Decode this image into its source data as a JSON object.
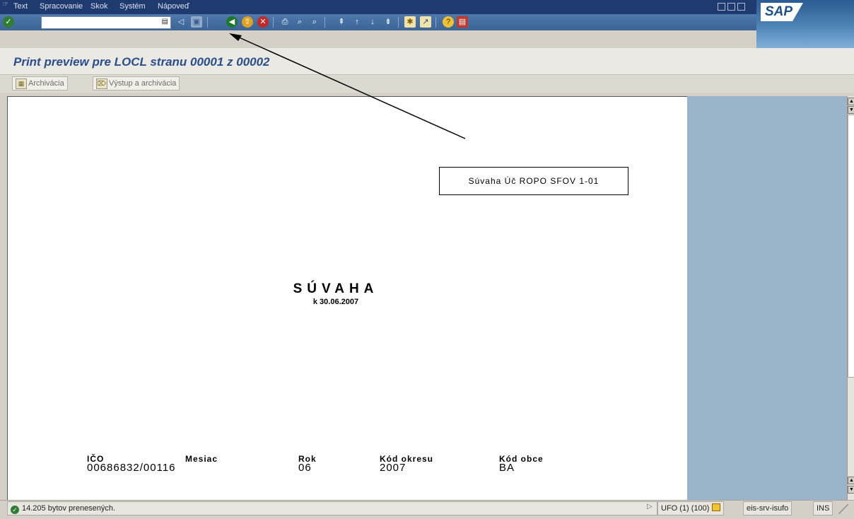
{
  "menu": {
    "items": [
      "Text",
      "Spracovanie",
      "Skok",
      "Systém",
      "Nápoveď"
    ]
  },
  "logo": "SAP",
  "toolbar": {
    "command_value": ""
  },
  "title": "Print preview pre LOCL stranu 00001 z 00002",
  "app_buttons": [
    "Archivácia",
    "Výstup a archivácia"
  ],
  "document": {
    "box_text": "Súvaha  Úč ROPO SFOV 1-01",
    "heading": "SÚVAHA",
    "date": "k 30.06.2007",
    "fields": [
      {
        "label": "IČO",
        "value": "00686832/00116"
      },
      {
        "label": "Mesiac",
        "value": ""
      },
      {
        "label": "Rok",
        "value": "06"
      },
      {
        "label": "Kód okresu",
        "value": "2007"
      },
      {
        "label": "Kód obce",
        "value": "BA"
      }
    ]
  },
  "status": {
    "message": "14.205 bytov prenesených.",
    "system": "UFO (1) (100)",
    "server": "eis-srv-isufo",
    "mode": "INS"
  },
  "colors": {
    "menubar": "#1f3a6e",
    "toolbar": "#3b6496",
    "title": "#2b4e8c",
    "side_panel": "#9ab5c9"
  }
}
